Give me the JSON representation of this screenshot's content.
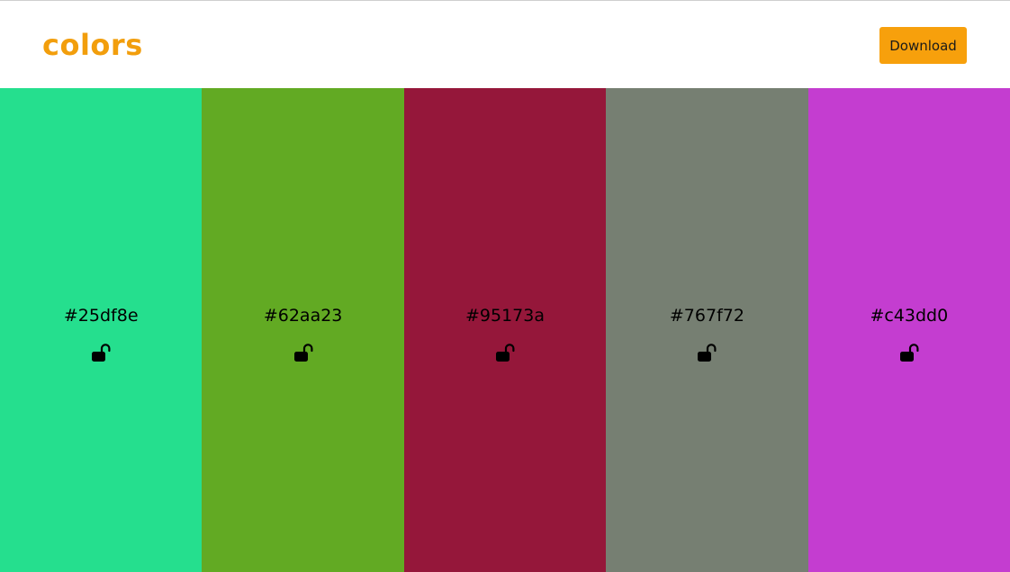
{
  "header": {
    "logo_text": "colors",
    "logo_color": "#f29e0c",
    "download_label": "Download",
    "download_color": "#f7a00c"
  },
  "palette": {
    "swatches": [
      {
        "hex": "#25df8e",
        "locked": false,
        "lock_icon": "lock-open-icon"
      },
      {
        "hex": "#62aa23",
        "locked": false,
        "lock_icon": "lock-open-icon"
      },
      {
        "hex": "#95173a",
        "locked": false,
        "lock_icon": "lock-open-icon"
      },
      {
        "hex": "#767f72",
        "locked": false,
        "lock_icon": "lock-open-icon"
      },
      {
        "hex": "#c43dd0",
        "locked": false,
        "lock_icon": "lock-open-icon"
      }
    ]
  }
}
